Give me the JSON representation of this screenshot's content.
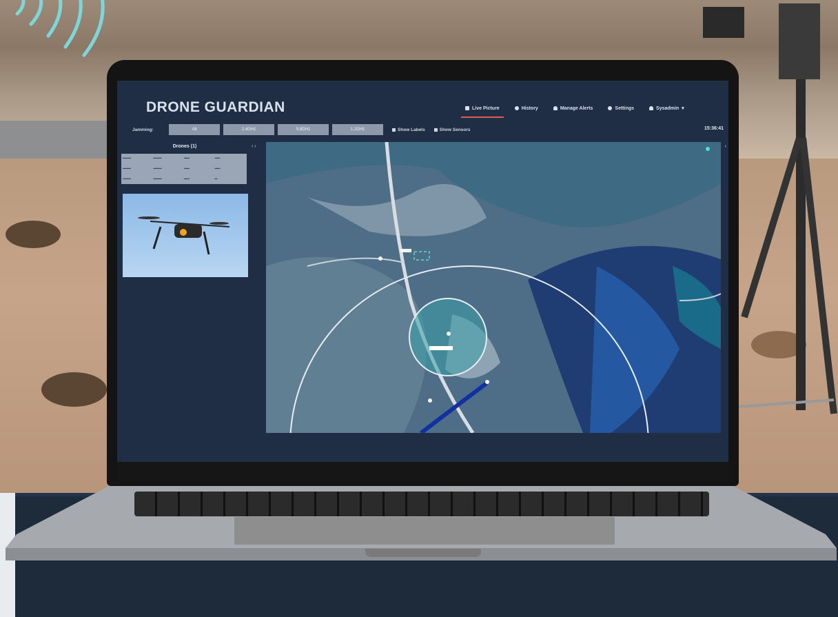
{
  "app": {
    "title": "DRONE GUARDIAN"
  },
  "nav": {
    "items": [
      {
        "label": "Live Picture",
        "icon": "camera-icon",
        "active": true
      },
      {
        "label": "History",
        "icon": "history-icon",
        "active": false
      },
      {
        "label": "Manage Alerts",
        "icon": "bell-icon",
        "active": false
      },
      {
        "label": "Settings",
        "icon": "gear-icon",
        "active": false
      },
      {
        "label": "Sysadmin",
        "icon": "user-icon",
        "active": false
      }
    ]
  },
  "toolbar": {
    "jamming_label": "Jamming:",
    "jamming_options": [
      "All",
      "2.4GHz",
      "5.8GHz",
      "1.2GHz"
    ],
    "show_labels": "Show Labels",
    "show_sensors": "Show Sensors",
    "time": "15:36:41"
  },
  "sidebar": {
    "drones_heading": "Drones (1)"
  },
  "colors": {
    "screen_bg": "#1f2d45",
    "active_tab_underline": "#e05a5a",
    "map_circle": "#e8edf4"
  }
}
